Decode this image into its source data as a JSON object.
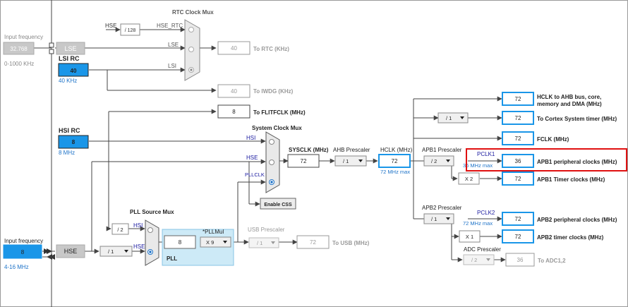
{
  "colors": {
    "accent_blue": "#1a96e8",
    "label_blue": "#1e73c8",
    "highlight_red": "#e01010",
    "pll_bg": "#cdeaf7",
    "gray_box": "#c8c8c8"
  },
  "left_panel": {
    "lse_input_label": "Input frequency",
    "lse_input_value": "32.768",
    "lse_range": "0-1000 KHz",
    "lse_label": "LSE",
    "lsi_title": "LSI RC",
    "lsi_value": "40",
    "lsi_sub": "40 KHz",
    "hsi_title": "HSI RC",
    "hsi_value": "8",
    "hsi_sub": "8 MHz",
    "hse_input_label": "Input frequency",
    "hse_input_value": "8",
    "hse_range": "4-16 MHz",
    "hse_label": "HSE"
  },
  "rtc": {
    "title": "RTC Clock Mux",
    "hse_in": "HSE",
    "div": "/ 128",
    "hse_rtc": "HSE_RTC",
    "lse": "LSE",
    "lsi": "LSI",
    "rtc_value": "40",
    "rtc_label": "To RTC (KHz)",
    "iwdg_value": "40",
    "iwdg_label": "To IWDG (KHz)",
    "flit_value": "8",
    "flit_label": "To FLITFCLK (MHz)"
  },
  "sysclk": {
    "title": "System Clock Mux",
    "hsi": "HSI",
    "hse": "HSE",
    "pllclk": "PLLCLK",
    "enable_css": "Enable CSS",
    "label": "SYSCLK (MHz)",
    "value": "72"
  },
  "ahb": {
    "label": "AHB Prescaler",
    "value": "/ 1",
    "hclk_label": "HCLK (MHz)",
    "hclk_value": "72",
    "hclk_max": "72 MHz max"
  },
  "pll": {
    "source_title": "PLL Source Mux",
    "hsi_div": "/ 2",
    "hsi": "HSI",
    "hse": "HSE",
    "hse_div": "/ 1",
    "input_value": "8",
    "mul_label": "*PLLMul",
    "mul_value": "X 9",
    "name": "PLL"
  },
  "usb": {
    "label": "USB Prescaler",
    "div": "/ 1",
    "value": "72",
    "target": "To USB (MHz)"
  },
  "apb1": {
    "label": "APB1 Prescaler",
    "div": "/ 2",
    "pclk": "PCLK1",
    "max": "36 MHz max",
    "periph_value": "36",
    "periph_label": "APB1 peripheral clocks (MHz)",
    "mul": "X 2",
    "timer_value": "72",
    "timer_label": "APB1 Timer clocks (MHz)"
  },
  "apb2": {
    "label": "APB2 Prescaler",
    "div": "/ 1",
    "pclk": "PCLK2",
    "max": "72 MHz max",
    "periph_value": "72",
    "periph_label": "APB2 peripheral clocks (MHz)",
    "mul": "X 1",
    "timer_value": "72",
    "timer_label": "APB2 timer clocks (MHz)"
  },
  "adc": {
    "label": "ADC Prescaler",
    "div": "/ 2",
    "value": "36",
    "target": "To ADC1,2"
  },
  "outputs": {
    "hclk_ahb_value": "72",
    "hclk_ahb_line1": "HCLK to AHB bus, core,",
    "hclk_ahb_line2": "memory and DMA (MHz)",
    "cortex_div": "/ 1",
    "cortex_value": "72",
    "cortex_label": "To Cortex System timer (MHz)",
    "fclk_value": "72",
    "fclk_label": "FCLK (MHz)"
  }
}
